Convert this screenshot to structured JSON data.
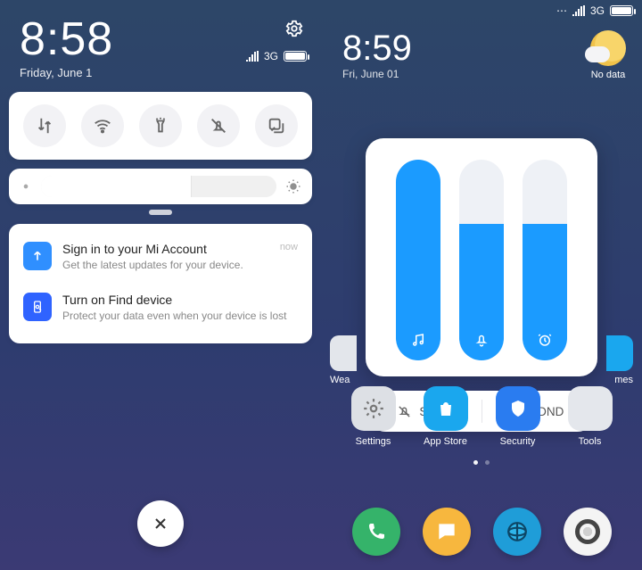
{
  "left": {
    "clock": "8:58",
    "date": "Friday, June 1",
    "network_label": "3G",
    "toggles": [
      "data-icon",
      "wifi-icon",
      "flashlight-icon",
      "mute-icon",
      "screenshot-icon"
    ],
    "notifications": [
      {
        "title": "Sign in to your Mi Account",
        "body": "Get the latest updates for your device.",
        "time": "now",
        "icon": "arrow-up-icon"
      },
      {
        "title": "Turn on Find device",
        "body": "Protect your data even when your device is lost",
        "time": "",
        "icon": "find-device-icon"
      }
    ],
    "brightness_pct": 64
  },
  "right": {
    "clock": "8:59",
    "date": "Fri, June 01",
    "network_label": "3G",
    "weather_label": "No data",
    "volume": {
      "media": 100,
      "ring": 68,
      "alarm": 68
    },
    "modes": {
      "silent": "Silent",
      "dnd": "DND"
    },
    "apps": [
      {
        "label": "Weather"
      },
      {
        "label": "Settings"
      },
      {
        "label": "App Store"
      },
      {
        "label": "Security"
      },
      {
        "label": "Themes"
      },
      {
        "label": "Tools"
      }
    ],
    "partial_app_left": "Wea",
    "partial_app_right": "mes"
  },
  "colors": {
    "accent": "#1b9bff"
  }
}
